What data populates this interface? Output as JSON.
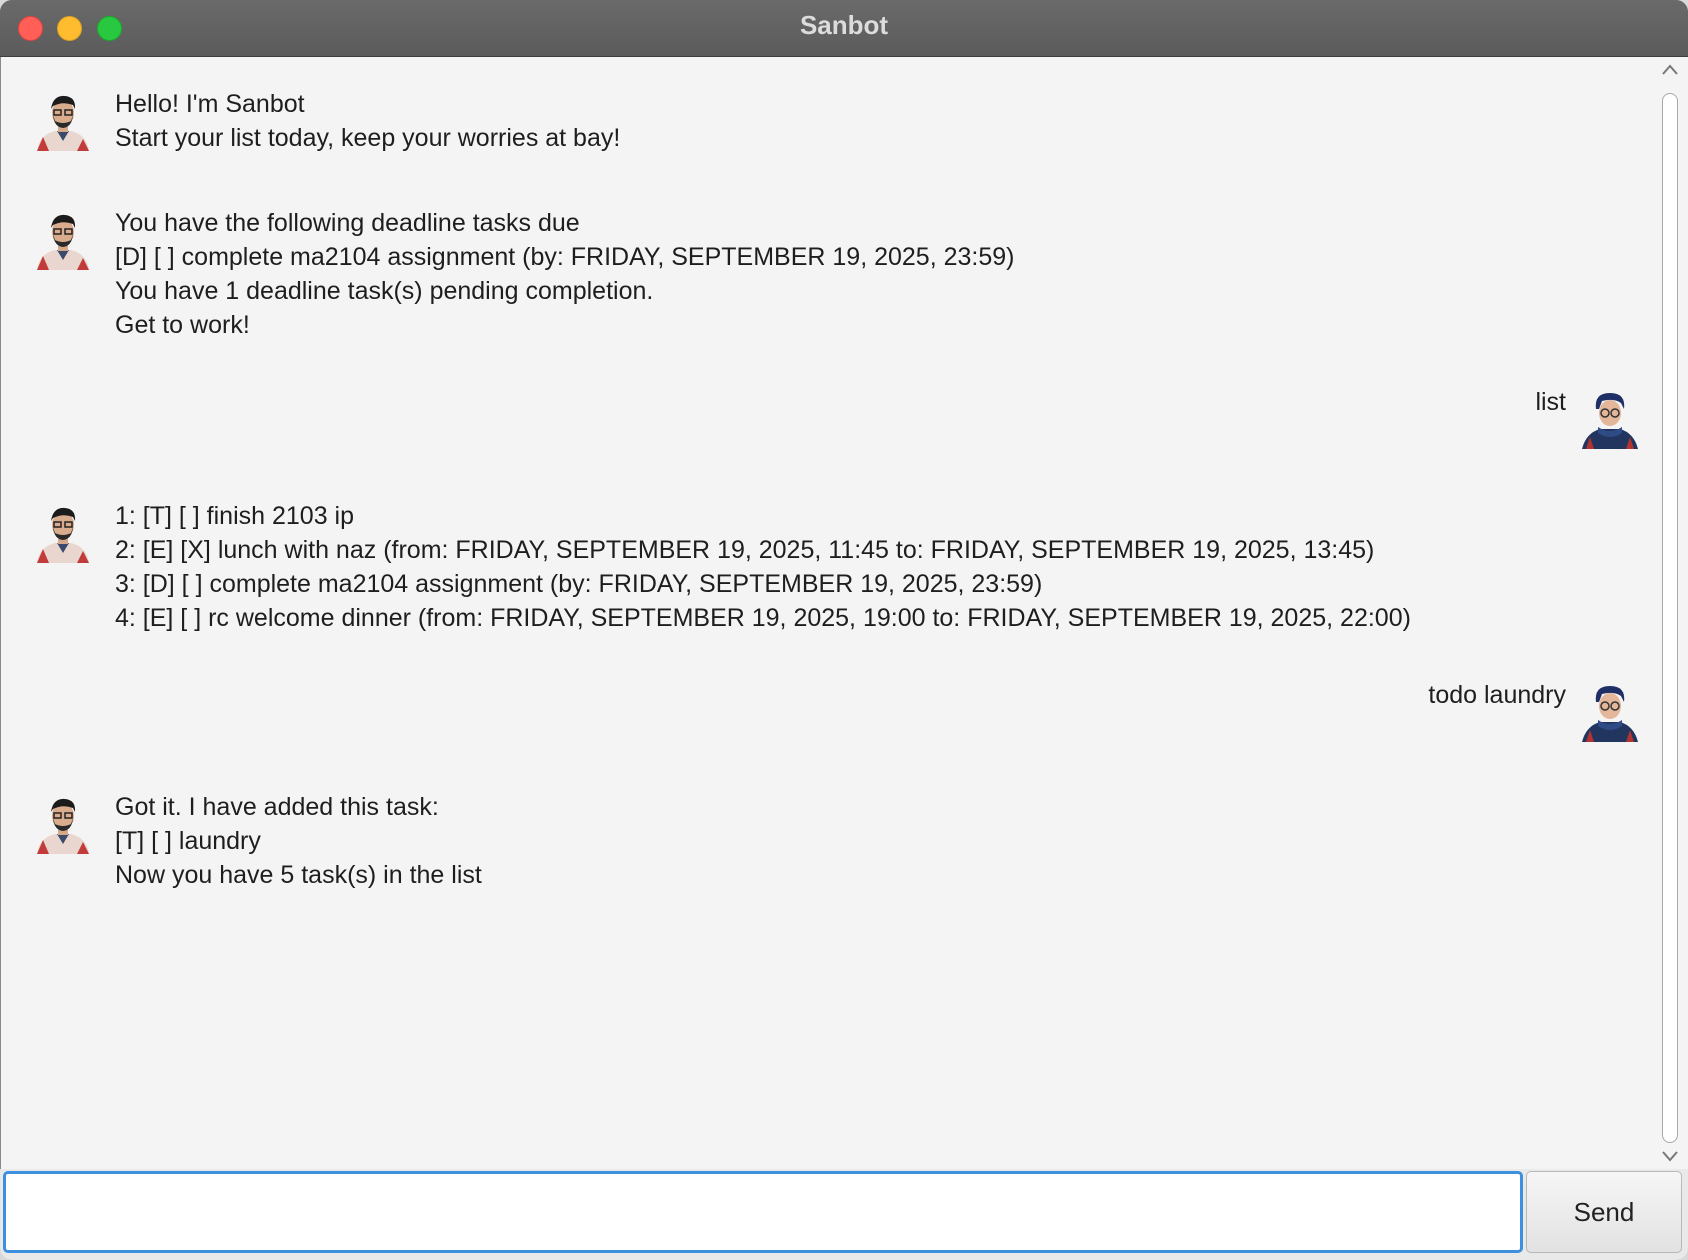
{
  "window": {
    "title": "Sanbot"
  },
  "messages": [
    {
      "sender": "bot",
      "lines": [
        "Hello! I'm Sanbot",
        "Start your list today, keep your worries at bay!"
      ]
    },
    {
      "sender": "bot",
      "lines": [
        "You have the following deadline tasks due",
        "[D] [ ] complete ma2104 assignment (by: FRIDAY, SEPTEMBER 19, 2025, 23:59)",
        "You have 1 deadline task(s) pending completion.",
        "Get to work!"
      ]
    },
    {
      "sender": "user",
      "lines": [
        "list"
      ]
    },
    {
      "sender": "bot",
      "lines": [
        "1: [T] [ ] finish 2103 ip",
        "2: [E] [X] lunch with naz (from: FRIDAY, SEPTEMBER 19, 2025, 11:45 to: FRIDAY, SEPTEMBER 19, 2025, 13:45)",
        "3: [D] [ ] complete ma2104 assignment (by: FRIDAY, SEPTEMBER 19, 2025, 23:59)",
        "4: [E] [ ] rc welcome dinner (from: FRIDAY, SEPTEMBER 19, 2025, 19:00 to: FRIDAY, SEPTEMBER 19, 2025, 22:00)"
      ]
    },
    {
      "sender": "user",
      "lines": [
        "todo laundry"
      ]
    },
    {
      "sender": "bot",
      "lines": [
        "Got it. I have added this task:",
        "[T] [ ] laundry",
        "Now you have 5 task(s) in the list"
      ]
    }
  ],
  "input": {
    "value": "",
    "placeholder": ""
  },
  "send_button": {
    "label": "Send"
  },
  "icons": {
    "bot_avatar": "bot-avatar-icon",
    "user_avatar": "user-avatar-icon"
  },
  "colors": {
    "focus_ring": "#3d8fdf",
    "close": "#ff5f57",
    "minimize": "#febc2e",
    "maximize": "#28c840"
  }
}
